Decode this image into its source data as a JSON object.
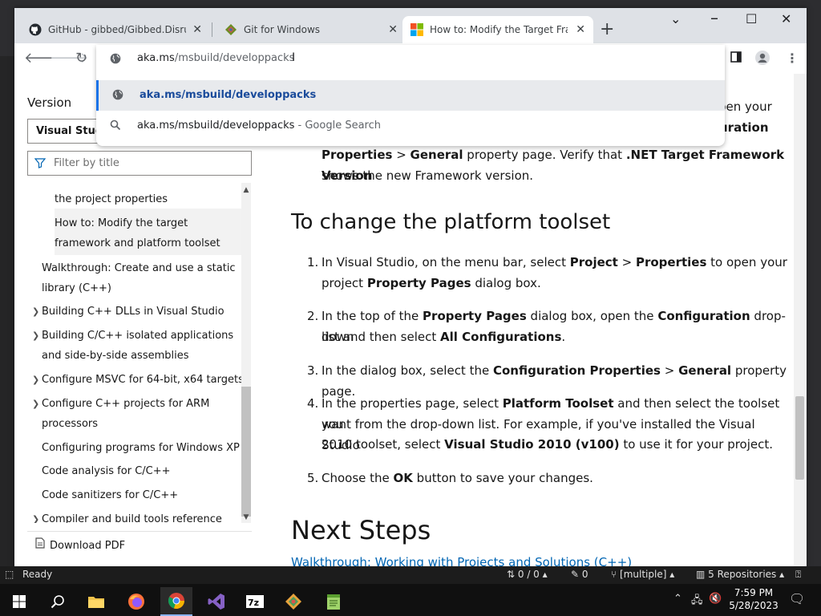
{
  "browser": {
    "tabs": [
      {
        "title": "GitHub - gibbed/Gibbed.Disrupt",
        "favicon": "github-icon"
      },
      {
        "title": "Git for Windows",
        "favicon": "git-icon"
      },
      {
        "title": "How to: Modify the Target Fram",
        "favicon": "microsoft-icon",
        "active": true
      }
    ],
    "omnibox": {
      "host": "aka.ms",
      "path": "/msbuild/developpacks",
      "suggestions": [
        {
          "text": "aka.ms/msbuild/developpacks",
          "icon": "globe-icon",
          "selected": true
        },
        {
          "text": "aka.ms/msbuild/developpacks",
          "suffix": " - Google Search",
          "icon": "search-icon"
        }
      ]
    }
  },
  "sidebar": {
    "version_label": "Version",
    "version_value": "Visual Studi",
    "filter_placeholder": "Filter by title",
    "toc": [
      {
        "label_lines": [
          "the project properties"
        ],
        "indent": 2
      },
      {
        "label_lines": [
          "How to: Modify the target",
          "framework and platform toolset"
        ],
        "indent": 2,
        "active": true
      },
      {
        "label_lines": [
          "Walkthrough: Create and use a static",
          "library (C++)"
        ],
        "indent": 1
      },
      {
        "label_lines": [
          "Building C++ DLLs in Visual Studio"
        ],
        "indent": 1,
        "expandable": true
      },
      {
        "label_lines": [
          "Building C/C++ isolated applications",
          "and side-by-side assemblies"
        ],
        "indent": 1,
        "expandable": true
      },
      {
        "label_lines": [
          "Configure MSVC for 64-bit, x64 targets"
        ],
        "indent": 1,
        "expandable": true
      },
      {
        "label_lines": [
          "Configure C++ projects for ARM",
          "processors"
        ],
        "indent": 1,
        "expandable": true
      },
      {
        "label_lines": [
          "Configuring programs for Windows XP"
        ],
        "indent": 1
      },
      {
        "label_lines": [
          "Code analysis for C/C++"
        ],
        "indent": 1
      },
      {
        "label_lines": [
          "Code sanitizers for C/C++"
        ],
        "indent": 1
      },
      {
        "label_lines": [
          "Compiler and build tools reference"
        ],
        "indent": 1,
        "expandable": true
      }
    ],
    "download_pdf": "Download PDF"
  },
  "article": {
    "partial_lines": [
      {
        "pre": "",
        "b1": "",
        "mid": "pen your",
        "b2": "",
        "post": ""
      },
      {
        "pre": "",
        "b1": "",
        "mid": "",
        "b2": "uration",
        "post": ""
      }
    ],
    "prev_step_line3": {
      "b1": "Properties",
      "sep": " > ",
      "b2": "General",
      "mid": " property page. Verify that ",
      "b3": ".NET Target Framework Version"
    },
    "prev_step_line4": "shows the new Framework version.",
    "heading": "To change the platform toolset",
    "steps": [
      {
        "num": "1.",
        "l1": [
          "In Visual Studio, on the menu bar, select ",
          "Project",
          " > ",
          "Properties",
          " to open your"
        ],
        "l2": [
          "project ",
          "Property Pages",
          " dialog box."
        ]
      },
      {
        "num": "2.",
        "l1": [
          "In the top of the ",
          "Property Pages",
          " dialog box, open the ",
          "Configuration",
          " drop-down"
        ],
        "l2": [
          "list and then select ",
          "All Configurations",
          "."
        ]
      },
      {
        "num": "3.",
        "l1": [
          "In the dialog box, select the ",
          "Configuration Properties",
          " > ",
          "General",
          " property page."
        ]
      },
      {
        "num": "4.",
        "l1": [
          "In the properties page, select ",
          "Platform Toolset",
          " and then select the toolset you"
        ],
        "l2": [
          "want from the drop-down list. For example, if you've installed the Visual Studio"
        ],
        "l3": [
          "2010 toolset, select ",
          "Visual Studio 2010 (v100)",
          " to use it for your project."
        ]
      },
      {
        "num": "5.",
        "l1": [
          "Choose the ",
          "OK",
          " button to save your changes."
        ]
      }
    ],
    "next_heading": "Next Steps",
    "next_link": "Walkthrough: Working with Projects and Solutions (C++)"
  },
  "statusbar": {
    "ready": "Ready",
    "errors": "0 / 0",
    "pencil_count": "0",
    "branch": "[multiple]",
    "repos": "5 Repositories"
  },
  "taskbar": {
    "time": "7:59 PM",
    "date": "5/28/2023",
    "apps": [
      "windows-start-icon",
      "search-icon",
      "file-explorer-icon",
      "firefox-icon",
      "chrome-icon",
      "visual-studio-icon",
      "7zip-icon",
      "git-extensions-icon",
      "notepad-plus-plus-icon"
    ]
  },
  "colors": {
    "accent": "#1a73e8",
    "link": "#0065b3",
    "tab_bar": "#dee1e6"
  }
}
